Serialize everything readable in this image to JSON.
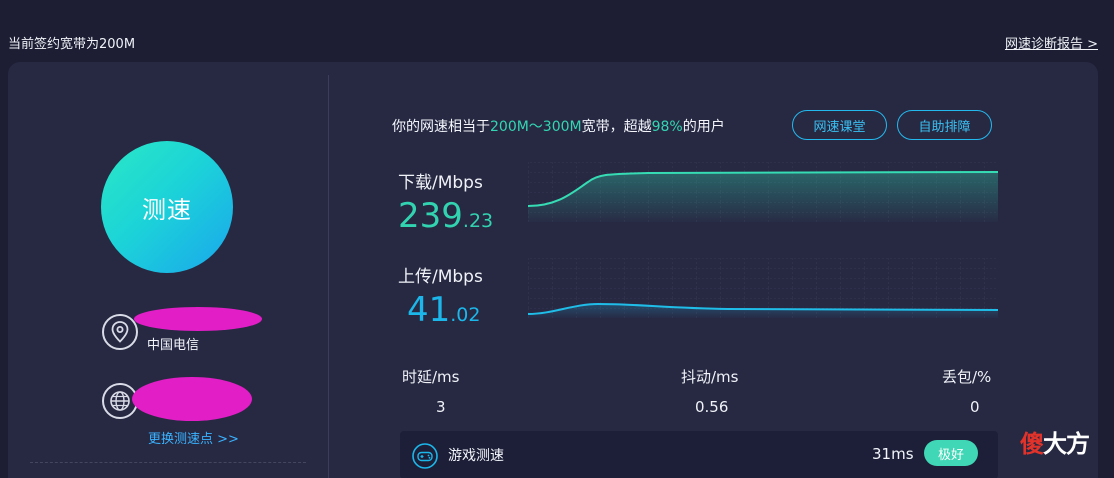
{
  "header": {
    "plan_text": "当前签约宽带为200M",
    "report_link": "网速诊断报告 >"
  },
  "left": {
    "speed_button": "测速",
    "isp": "中国电信",
    "change_node": "更换测速点 >>"
  },
  "summary": {
    "prefix": "你的网速相当于",
    "bandwidth_range": "200M～300M",
    "mid": "宽带，超越",
    "percent": "98%",
    "suffix": "的用户"
  },
  "buttons": {
    "course": "网速课堂",
    "self_diag": "自助排障"
  },
  "download": {
    "label": "下载/Mbps",
    "value_int": "239",
    "value_dec": ".23"
  },
  "upload": {
    "label": "上传/Mbps",
    "value_int": "41",
    "value_dec": ".02"
  },
  "stats": {
    "latency_label": "时延/ms",
    "latency_value": "3",
    "jitter_label": "抖动/ms",
    "jitter_value": "0.56",
    "loss_label": "丢包/%",
    "loss_value": "0"
  },
  "game": {
    "label": "游戏测速",
    "latency": "31ms",
    "badge": "极好"
  },
  "watermark": {
    "char_red": "傻",
    "rest": "大方"
  },
  "colors": {
    "background": "#1d1e33",
    "card": "#272943",
    "download_accent": "#31d3b0",
    "upload_accent": "#1cb7ea",
    "link_blue": "#3ab3ff",
    "badge_green": "#3fd7b5",
    "mask_magenta": "#e21ec7"
  },
  "icons": {
    "location": "location-pin-icon",
    "globe": "globe-icon",
    "game": "gamepad-icon"
  }
}
